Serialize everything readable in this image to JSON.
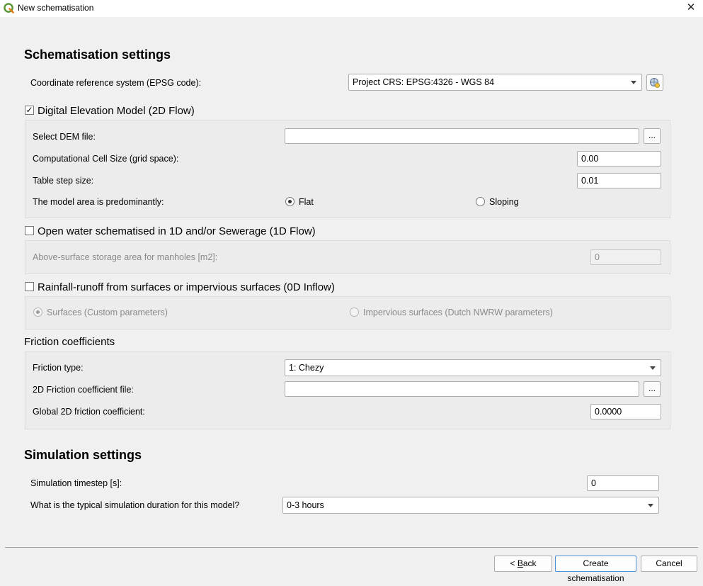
{
  "window": {
    "title": "New schematisation"
  },
  "schematisation": {
    "heading": "Schematisation settings",
    "crs_label": "Coordinate reference system (EPSG code):",
    "crs_value": "Project CRS: EPSG:4326 - WGS 84"
  },
  "dem": {
    "checkbox_label": "Digital Elevation Model (2D Flow)",
    "checked": true,
    "select_file_label": "Select DEM file:",
    "select_file_value": "",
    "browse_label": "...",
    "cell_size_label": "Computational Cell Size (grid space):",
    "cell_size_value": "0.00",
    "table_step_label": "Table step size:",
    "table_step_value": "0.01",
    "area_label": "The model area is predominantly:",
    "option_flat": "Flat",
    "option_sloping": "Sloping",
    "selected": "Flat"
  },
  "open_water": {
    "checkbox_label": "Open water schematised in 1D and/or Sewerage (1D Flow)",
    "checked": false,
    "storage_label": "Above-surface storage area for manholes [m2]:",
    "storage_value": "0"
  },
  "rainfall": {
    "checkbox_label": "Rainfall-runoff from surfaces or impervious surfaces (0D Inflow)",
    "checked": false,
    "option_surfaces": "Surfaces (Custom parameters)",
    "option_impervious": "Impervious surfaces (Dutch NWRW parameters)",
    "selected": "Surfaces (Custom parameters)"
  },
  "friction": {
    "heading": "Friction coefficients",
    "type_label": "Friction type:",
    "type_value": "1: Chezy",
    "file_label": "2D Friction coefficient file:",
    "file_value": "",
    "browse_label": "...",
    "global_label": "Global 2D friction coefficient:",
    "global_value": "0.0000"
  },
  "simulation": {
    "heading": "Simulation settings",
    "timestep_label": "Simulation timestep [s]:",
    "timestep_value": "0",
    "duration_label": "What is the typical simulation duration for this model?",
    "duration_value": "0-3 hours"
  },
  "buttons": {
    "back_prefix": "< ",
    "back_accel": "B",
    "back_rest": "ack",
    "create": "Create schematisation",
    "cancel": "Cancel"
  }
}
